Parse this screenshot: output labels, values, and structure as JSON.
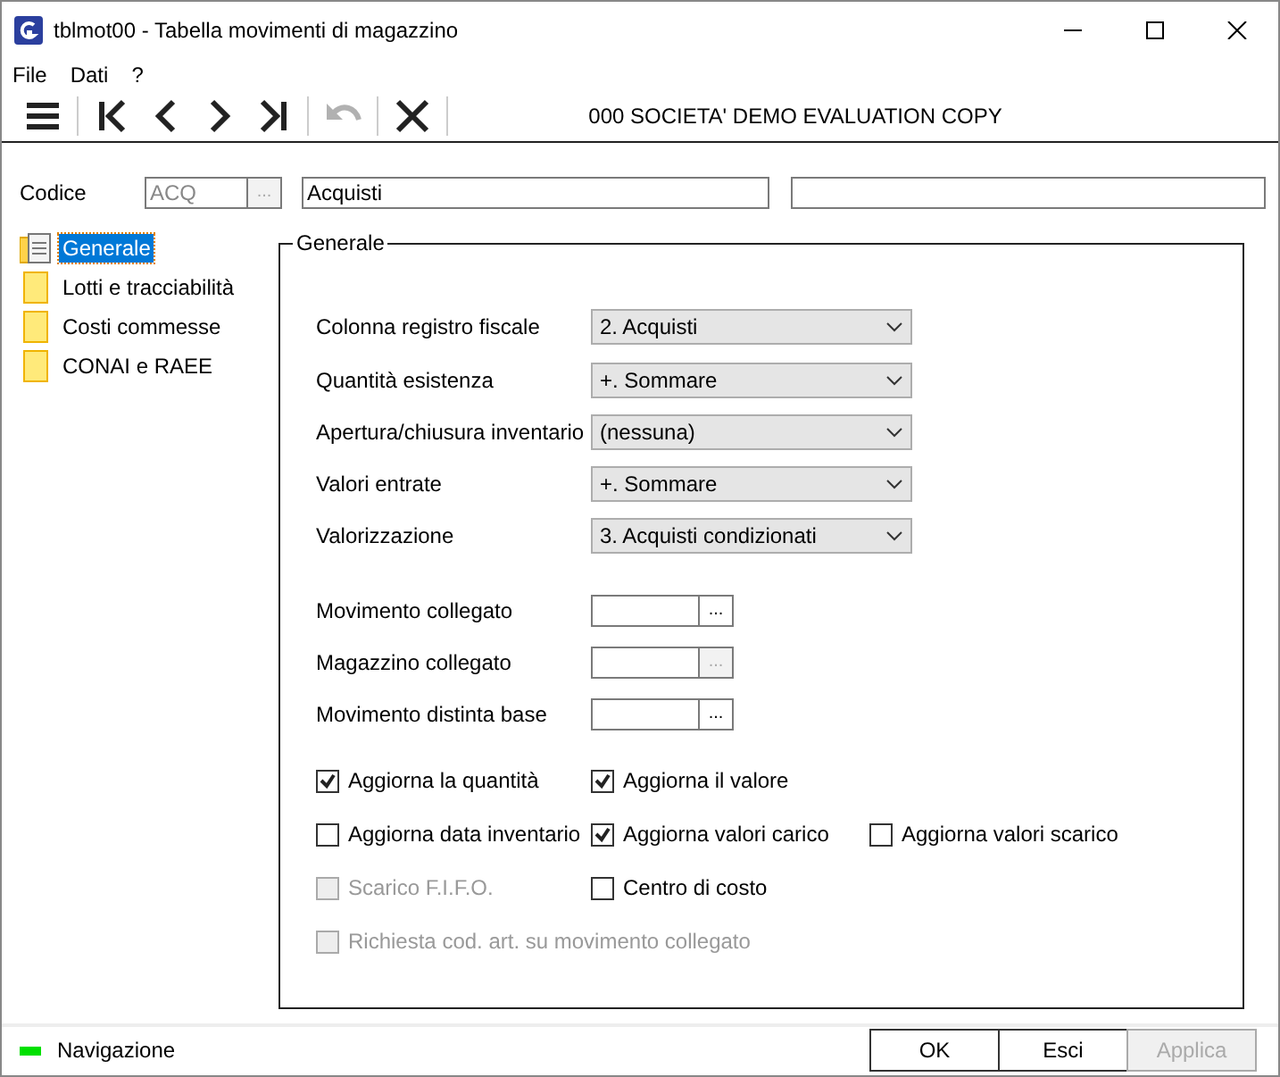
{
  "window": {
    "title": "tblmot00 - Tabella movimenti di magazzino"
  },
  "menu": [
    {
      "label": "File"
    },
    {
      "label": "Dati"
    },
    {
      "label": "?"
    }
  ],
  "toolbar": {
    "buttons": [
      {
        "kind": "menu",
        "disabled": false
      },
      {
        "kind": "first",
        "disabled": false
      },
      {
        "kind": "prev",
        "disabled": false
      },
      {
        "kind": "next",
        "disabled": false
      },
      {
        "kind": "last",
        "disabled": false
      },
      {
        "kind": "undo",
        "disabled": true
      },
      {
        "kind": "delete",
        "disabled": false
      }
    ],
    "company": "000 SOCIETA'  DEMO EVALUATION COPY"
  },
  "header": {
    "label": "Codice",
    "code": "ACQ",
    "code_disabled": true,
    "code_button": "...",
    "description": "Acquisti"
  },
  "sidebar": {
    "items": [
      {
        "label": "Generale",
        "kind": "document",
        "selected": true
      },
      {
        "label": "Lotti e tracciabilità",
        "kind": "folder",
        "selected": false
      },
      {
        "label": "Costi commesse",
        "kind": "folder",
        "selected": false
      },
      {
        "label": "CONAI e RAEE",
        "kind": "folder",
        "selected": false
      }
    ]
  },
  "group": {
    "title": "Generale",
    "combos": [
      {
        "label": "Colonna registro fiscale",
        "value": "2. Acquisti"
      },
      {
        "label": "Quantità esistenza",
        "value": "+. Sommare"
      },
      {
        "label": "Apertura/chiusura inventario",
        "value": "(nessuna)"
      },
      {
        "label": "Valori entrate",
        "value": "+. Sommare"
      },
      {
        "label": "Valorizzazione",
        "value": "3. Acquisti condizionati"
      }
    ],
    "lookups": [
      {
        "label": "Movimento collegato",
        "button": "...",
        "disabled": false
      },
      {
        "label": "Magazzino collegato",
        "button": "...",
        "disabled": true
      },
      {
        "label": "Movimento distinta base",
        "button": "...",
        "disabled": false
      }
    ],
    "checkbox_rows": [
      [
        {
          "label": "Aggiorna la quantità",
          "checked": true,
          "disabled": false
        },
        {
          "label": "Aggiorna il valore",
          "checked": true,
          "disabled": false
        }
      ],
      [
        {
          "label": "Aggiorna data inventario",
          "checked": false,
          "disabled": false
        },
        {
          "label": "Aggiorna valori carico",
          "checked": true,
          "disabled": false
        },
        {
          "label": "Aggiorna valori scarico",
          "checked": false,
          "disabled": false
        }
      ],
      [
        {
          "label": "Scarico F.I.F.O.",
          "checked": false,
          "disabled": true
        },
        {
          "label": "Centro di costo",
          "checked": false,
          "disabled": false
        }
      ],
      [
        {
          "label": "Richiesta cod. art. su movimento collegato",
          "checked": false,
          "disabled": true
        }
      ]
    ]
  },
  "status_bar": {
    "mode": "Navigazione",
    "color": "#00e000"
  },
  "buttons": [
    {
      "label": "OK",
      "disabled": false
    },
    {
      "label": "Esci",
      "disabled": false
    },
    {
      "label": "Applica",
      "disabled": true
    }
  ]
}
